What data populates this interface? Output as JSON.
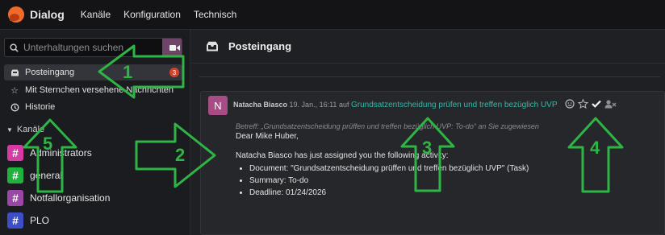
{
  "app": {
    "name": "Dialog",
    "menu": [
      "Kanäle",
      "Konfiguration",
      "Technisch"
    ]
  },
  "colors": {
    "accent": "#35b8a8",
    "annotation": "#2fb545",
    "badge": "#d1432f"
  },
  "sidebar": {
    "search_placeholder": "Unterhaltungen suchen",
    "items": [
      {
        "label": "Posteingang",
        "icon": "inbox-icon",
        "badge": "3",
        "active": true
      },
      {
        "label": "Mit Sternchen versehene Nachrichten",
        "icon": "star-icon"
      },
      {
        "label": "Historie",
        "icon": "history-icon"
      }
    ],
    "section_title": "Kanäle",
    "channels": [
      {
        "label": "Administrators",
        "color": "#d63aa3"
      },
      {
        "label": "general",
        "color": "#1fb23c"
      },
      {
        "label": "Notfallorganisation",
        "color": "#9a47a8"
      },
      {
        "label": "PLO",
        "color": "#3d4fc7"
      }
    ]
  },
  "main": {
    "title": "Posteingang",
    "message": {
      "avatar_letter": "N",
      "author": "Natacha Biasco",
      "date": "19. Jan., 16:11",
      "on": "auf",
      "subject": "Grundsatzentscheidung prüfen und treffen bezüglich UVP",
      "re_line": "Betreff: „Grundsatzentscheidung prüffen und treffen bezüglich UVP: To-do“ an Sie zugewiesen",
      "greeting": "Dear Mike Huber,",
      "text": "Natacha Biasco has just assigned you the following activity:",
      "bullets": [
        "Document: \"Grundsatzentscheidung prüffen und treffen bezüglich UVP\" (Task)",
        "Summary: To-do",
        "Deadline: 01/24/2026"
      ]
    }
  },
  "annotations": [
    "1",
    "2",
    "3",
    "4",
    "5"
  ]
}
